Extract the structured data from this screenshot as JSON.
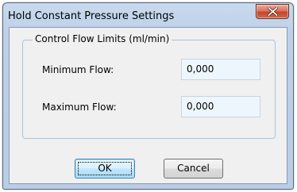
{
  "window": {
    "title": "Hold Constant Pressure Settings"
  },
  "titlebar": {
    "close_icon": "close-icon"
  },
  "group": {
    "legend": "Control Flow Limits (ml/min)",
    "min_label": "Minimum Flow:",
    "min_value": "0,000",
    "max_label": "Maximum Flow:",
    "max_value": "0,000"
  },
  "buttons": {
    "ok_label": "OK",
    "cancel_label": "Cancel"
  },
  "colors": {
    "close_button": "#c3452b",
    "frame": "#bdd0e8",
    "client": "#f0f0f0",
    "input_bg": "#eef6fd"
  }
}
